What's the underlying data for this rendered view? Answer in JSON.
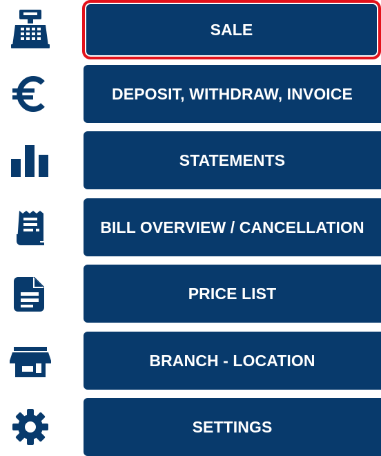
{
  "menu": {
    "items": [
      {
        "label": "SALE",
        "icon": "cash-register-icon",
        "selected": true
      },
      {
        "label": "DEPOSIT, WITHDRAW, INVOICE",
        "icon": "euro-icon",
        "selected": false
      },
      {
        "label": "STATEMENTS",
        "icon": "bar-chart-icon",
        "selected": false
      },
      {
        "label": "BILL OVERVIEW / CANCELLATION",
        "icon": "receipt-icon",
        "selected": false
      },
      {
        "label": "PRICE LIST",
        "icon": "document-icon",
        "selected": false
      },
      {
        "label": "BRANCH - LOCATION",
        "icon": "store-icon",
        "selected": false
      },
      {
        "label": "SETTINGS",
        "icon": "gear-icon",
        "selected": false
      }
    ]
  },
  "colors": {
    "button_background": "#083a6c",
    "icon_color": "#083a6c",
    "selection_border": "#e3121b",
    "button_text": "#ffffff"
  }
}
